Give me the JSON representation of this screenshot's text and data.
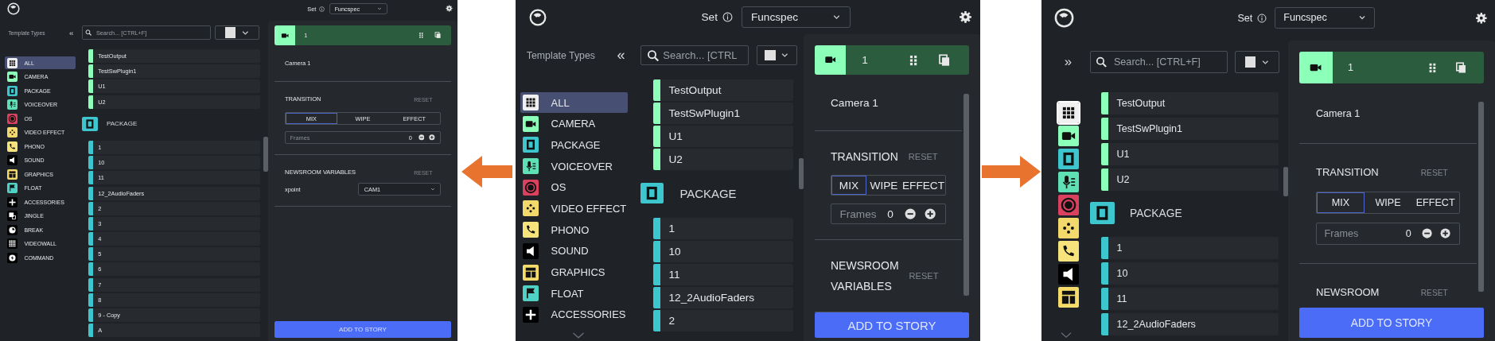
{
  "screens": [
    {
      "set_label": "Set",
      "set_value": "Funcspec",
      "sidebar": {
        "title": "Template Types",
        "toggle": "«",
        "collapsed": false,
        "more_below": false,
        "items": [
          {
            "kind": "all",
            "label": "ALL",
            "color": "#f0f0f0",
            "selected": true
          },
          {
            "kind": "camera",
            "label": "CAMERA",
            "color": "#8cffb8",
            "selected": false
          },
          {
            "kind": "package",
            "label": "PACKAGE",
            "color": "#3ec6cf",
            "selected": false
          },
          {
            "kind": "voiceover",
            "label": "VOICEOVER",
            "color": "#5ee0b4",
            "selected": false
          },
          {
            "kind": "os",
            "label": "OS",
            "color": "#d9415f",
            "selected": false
          },
          {
            "kind": "video_effect",
            "label": "VIDEO EFFECT",
            "color": "#f3d86b",
            "selected": false
          },
          {
            "kind": "phono",
            "label": "PHONO",
            "color": "#f6e37c",
            "selected": false
          },
          {
            "kind": "sound",
            "label": "SOUND",
            "color": "#000000",
            "selected": false
          },
          {
            "kind": "graphics",
            "label": "GRAPHICS",
            "color": "#f5dc6a",
            "selected": false
          },
          {
            "kind": "float",
            "label": "FLOAT",
            "color": "#4fd1c5",
            "selected": false
          },
          {
            "kind": "accessories",
            "label": "ACCESSORIES",
            "color": "#000000",
            "selected": false
          },
          {
            "kind": "jingle",
            "label": "JINGLE",
            "color": "#000000",
            "selected": false
          },
          {
            "kind": "break",
            "label": "BREAK",
            "color": "#000000",
            "selected": false
          },
          {
            "kind": "videowall",
            "label": "VIDEOWALL",
            "color": "#000000",
            "selected": false
          },
          {
            "kind": "command",
            "label": "COMMAND",
            "color": "#000000",
            "selected": false
          }
        ]
      },
      "search": {
        "placeholder": "Search... [CTRL+F]"
      },
      "groups": [
        {
          "color": "#8cffb8",
          "items": [
            "TestOutput",
            "TestSwPlugin1",
            "U1",
            "U2"
          ]
        },
        {
          "title": "PACKAGE",
          "kind": "package",
          "color": "#3ec6cf",
          "items": [
            "1",
            "10",
            "11",
            "12_2AudioFaders",
            "2",
            "3",
            "4",
            "5",
            "6",
            "7",
            "8",
            "9 - Copy",
            "A"
          ]
        }
      ],
      "panel": {
        "header": {
          "kind": "camera",
          "title": "1"
        },
        "description": "Camera 1",
        "scrollable": false,
        "transition": {
          "title": "TRANSITION",
          "reset": "RESET",
          "options": [
            {
              "label": "MIX",
              "selected": true
            },
            {
              "label": "WIPE",
              "selected": false
            },
            {
              "label": "EFFECT",
              "selected": false
            }
          ],
          "frames_label": "Frames",
          "frames_value": "0"
        },
        "newsroom": {
          "title": "NEWSROOM VARIABLES",
          "reset": "RESET",
          "variables": [
            {
              "name": "xpoint",
              "value": "CAM1"
            }
          ]
        },
        "add_button": "ADD TO STORY"
      }
    },
    {
      "set_label": "Set",
      "set_value": "Funcspec",
      "sidebar": {
        "title": "Template Types",
        "toggle": "«",
        "collapsed": false,
        "more_below": true,
        "items": [
          {
            "kind": "all",
            "label": "ALL",
            "color": "#f0f0f0",
            "selected": true
          },
          {
            "kind": "camera",
            "label": "CAMERA",
            "color": "#8cffb8",
            "selected": false
          },
          {
            "kind": "package",
            "label": "PACKAGE",
            "color": "#3ec6cf",
            "selected": false
          },
          {
            "kind": "voiceover",
            "label": "VOICEOVER",
            "color": "#5ee0b4",
            "selected": false
          },
          {
            "kind": "os",
            "label": "OS",
            "color": "#d9415f",
            "selected": false
          },
          {
            "kind": "video_effect",
            "label": "VIDEO EFFECT",
            "color": "#f3d86b",
            "selected": false
          },
          {
            "kind": "phono",
            "label": "PHONO",
            "color": "#f6e37c",
            "selected": false
          },
          {
            "kind": "sound",
            "label": "SOUND",
            "color": "#000000",
            "selected": false
          },
          {
            "kind": "graphics",
            "label": "GRAPHICS",
            "color": "#f5dc6a",
            "selected": false
          },
          {
            "kind": "float",
            "label": "FLOAT",
            "color": "#4fd1c5",
            "selected": false
          },
          {
            "kind": "accessories",
            "label": "ACCESSORIES",
            "color": "#000000",
            "selected": false
          }
        ]
      },
      "search": {
        "placeholder": "Search... [CTRL"
      },
      "groups": [
        {
          "color": "#8cffb8",
          "items": [
            "TestOutput",
            "TestSwPlugin1",
            "U1",
            "U2"
          ]
        },
        {
          "title": "PACKAGE",
          "kind": "package",
          "color": "#3ec6cf",
          "items": [
            "1",
            "10",
            "11",
            "12_2AudioFaders",
            "2"
          ]
        }
      ],
      "panel": {
        "header": {
          "kind": "camera",
          "title": "1"
        },
        "description": "Camera 1",
        "scrollable": true,
        "transition": {
          "title": "TRANSITION",
          "reset": "RESET",
          "options": [
            {
              "label": "MIX",
              "selected": true
            },
            {
              "label": "WIPE",
              "selected": false
            },
            {
              "label": "EFFECT",
              "selected": false
            }
          ],
          "frames_label": "Frames",
          "frames_value": "0"
        },
        "newsroom": {
          "title": "NEWSROOM VARIABLES",
          "reset": "RESET"
        },
        "add_button": "ADD TO STORY"
      }
    },
    {
      "set_label": "Set",
      "set_value": "Funcspec",
      "sidebar": {
        "toggle": "»",
        "collapsed": true,
        "more_below": true,
        "items": [
          {
            "kind": "all",
            "color": "#f0f0f0",
            "selected": true
          },
          {
            "kind": "camera",
            "color": "#8cffb8",
            "selected": false
          },
          {
            "kind": "package",
            "color": "#3ec6cf",
            "selected": false
          },
          {
            "kind": "voiceover",
            "color": "#5ee0b4",
            "selected": false
          },
          {
            "kind": "os",
            "color": "#d9415f",
            "selected": false
          },
          {
            "kind": "video_effect",
            "color": "#f3d86b",
            "selected": false
          },
          {
            "kind": "phono",
            "color": "#f6e37c",
            "selected": false
          },
          {
            "kind": "sound",
            "color": "#000000",
            "selected": false
          },
          {
            "kind": "graphics",
            "color": "#f5dc6a",
            "selected": false
          }
        ]
      },
      "search": {
        "placeholder": "Search... [CTRL+F]"
      },
      "groups": [
        {
          "color": "#8cffb8",
          "items": [
            "TestOutput",
            "TestSwPlugin1",
            "U1",
            "U2"
          ]
        },
        {
          "title": "PACKAGE",
          "kind": "package",
          "color": "#3ec6cf",
          "items": [
            "1",
            "10",
            "11",
            "12_2AudioFaders"
          ]
        }
      ],
      "panel": {
        "header": {
          "kind": "camera",
          "title": "1"
        },
        "description": "Camera 1",
        "scrollable": true,
        "transition": {
          "title": "TRANSITION",
          "reset": "RESET",
          "options": [
            {
              "label": "MIX",
              "selected": true
            },
            {
              "label": "WIPE",
              "selected": false
            },
            {
              "label": "EFFECT",
              "selected": false
            }
          ],
          "frames_label": "Frames",
          "frames_value": "0"
        },
        "newsroom": {
          "title": "NEWSROOM",
          "reset": "RESET"
        },
        "add_button": "ADD TO STORY"
      }
    }
  ],
  "arrows": [
    {
      "kind": "left"
    },
    {
      "kind": "right"
    }
  ]
}
